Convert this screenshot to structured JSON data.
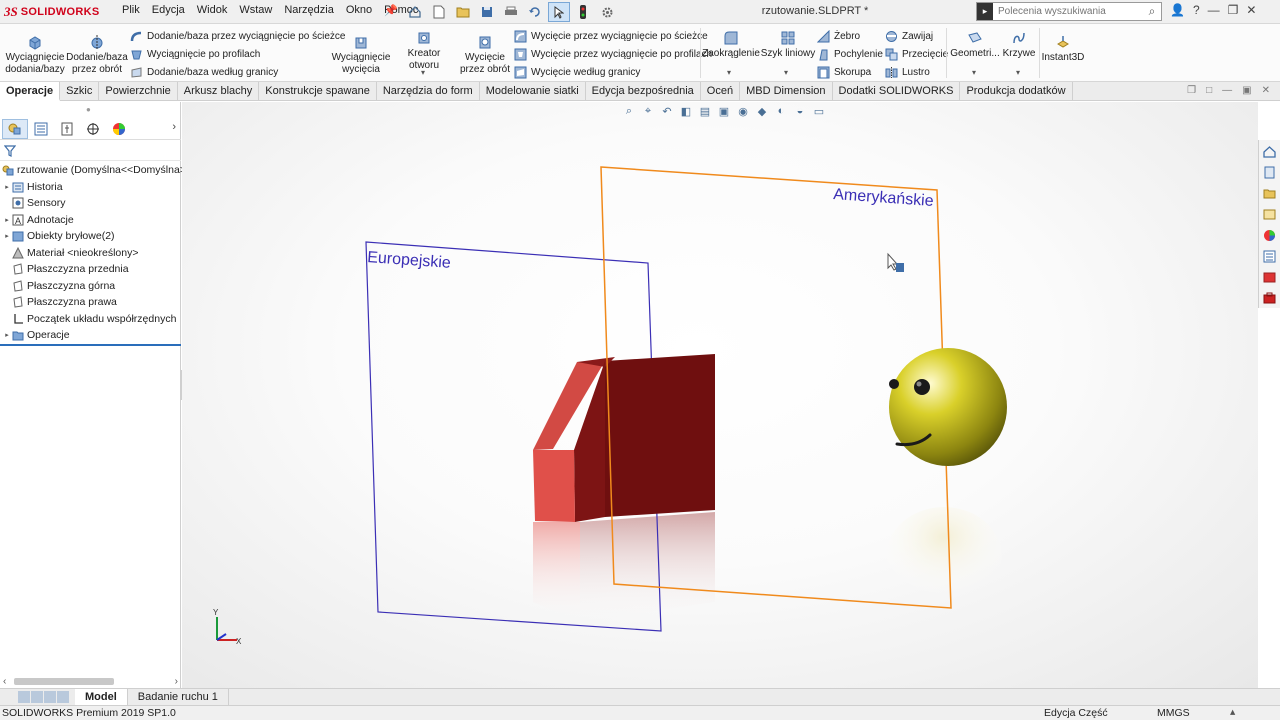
{
  "app": {
    "logo_ds": "3S",
    "logo_text": "SOLIDWORKS",
    "document_title": "rzutowanie.SLDPRT *"
  },
  "menu": [
    "Plik",
    "Edycja",
    "Widok",
    "Wstaw",
    "Narzędzia",
    "Okno",
    "Pomoc"
  ],
  "search": {
    "placeholder": "Polecenia wyszukiwania"
  },
  "ribbon": {
    "extrude_boss": "Wyciągnięcie dodania/bazy",
    "revolve_boss": "Dodanie/baza przez obrót",
    "sweep_boss": "Dodanie/baza przez wyciągnięcie po ścieżce",
    "loft_boss": "Wyciągnięcie po profilach",
    "boundary_boss": "Dodanie/baza według granicy",
    "extrude_cut": "Wyciągnięcie wycięcia",
    "hole_wizard": "Kreator otworu",
    "revolve_cut": "Wycięcie przez obrót",
    "sweep_cut": "Wycięcie przez wyciągnięcie po ścieżce",
    "loft_cut": "Wycięcie przez wyciągnięcie po profilach",
    "boundary_cut": "Wycięcie według granicy",
    "fillet": "Zaokrąglenie",
    "linear_pattern": "Szyk liniowy",
    "rib": "Żebro",
    "draft": "Pochylenie",
    "shell": "Skorupa",
    "wrap": "Zawijaj",
    "intersect": "Przecięcie",
    "mirror": "Lustro",
    "geometry": "Geometri...",
    "curves": "Krzywe",
    "instant3d": "Instant3D"
  },
  "tabs": [
    {
      "label": "Operacje",
      "active": true
    },
    {
      "label": "Szkic"
    },
    {
      "label": "Powierzchnie"
    },
    {
      "label": "Arkusz blachy"
    },
    {
      "label": "Konstrukcje spawane"
    },
    {
      "label": "Narzędzia do form"
    },
    {
      "label": "Modelowanie siatki"
    },
    {
      "label": "Edycja bezpośrednia"
    },
    {
      "label": "Oceń"
    },
    {
      "label": "MBD Dimension"
    },
    {
      "label": "Dodatki SOLIDWORKS"
    },
    {
      "label": "Produkcja dodatków"
    }
  ],
  "tree": {
    "root": "rzutowanie  (Domyślna<<Domyślna>",
    "items": [
      {
        "label": "Historia",
        "icon": "folder-history-icon",
        "expander": true
      },
      {
        "label": "Sensory",
        "icon": "sensor-icon",
        "expander": false
      },
      {
        "label": "Adnotacje",
        "icon": "annotation-icon",
        "expander": true
      },
      {
        "label": "Obiekty bryłowe(2)",
        "icon": "solid-bodies-icon",
        "expander": true
      },
      {
        "label": "Materiał <nieokreślony>",
        "icon": "material-icon",
        "expander": false
      },
      {
        "label": "Płaszczyzna przednia",
        "icon": "plane-icon",
        "expander": false
      },
      {
        "label": "Płaszczyzna górna",
        "icon": "plane-icon",
        "expander": false
      },
      {
        "label": "Płaszczyzna prawa",
        "icon": "plane-icon",
        "expander": false
      },
      {
        "label": "Początek układu współrzędnych",
        "icon": "origin-icon",
        "expander": false
      },
      {
        "label": "Operacje",
        "icon": "folder-icon",
        "expander": true
      }
    ]
  },
  "viewport": {
    "plane_european_label": "Europejskie",
    "plane_american_label": "Amerykańskie",
    "triad_y": "Y",
    "triad_x": "X",
    "colors": {
      "european_plane": "#3b2fb5",
      "american_plane": "#f08a1c",
      "block_top": "#7d1414",
      "block_front": "#6f0f0f",
      "block_side": "#e0504a",
      "sphere": "#c9c21a"
    }
  },
  "bottom_tabs": [
    {
      "label": "Model",
      "active": true
    },
    {
      "label": "Badanie ruchu 1"
    }
  ],
  "status": {
    "left": "SOLIDWORKS Premium 2019 SP1.0",
    "mode": "Edycja Część",
    "units": "MMGS"
  }
}
